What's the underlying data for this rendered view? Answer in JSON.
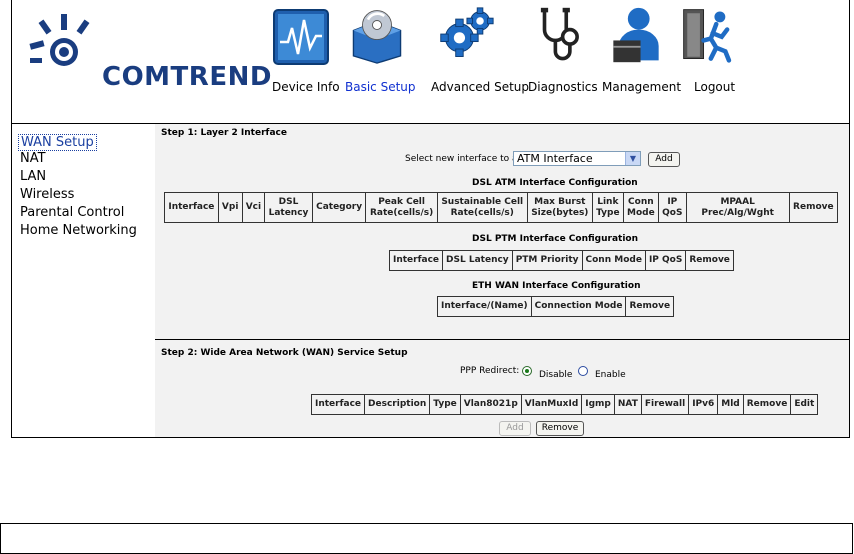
{
  "brand": {
    "logo_text": "COMTREND"
  },
  "nav": [
    {
      "label": "Device Info",
      "icon": "device-info-icon"
    },
    {
      "label": "Basic Setup",
      "icon": "basic-setup-icon",
      "active": true
    },
    {
      "label": "Advanced Setup",
      "icon": "advanced-setup-icon"
    },
    {
      "label": "Diagnostics",
      "icon": "diagnostics-icon"
    },
    {
      "label": "Management",
      "icon": "management-icon"
    },
    {
      "label": "Logout",
      "icon": "logout-icon"
    }
  ],
  "sidebar": [
    {
      "label": "WAN Setup",
      "active": true
    },
    {
      "label": "NAT"
    },
    {
      "label": "LAN"
    },
    {
      "label": "Wireless"
    },
    {
      "label": "Parental Control"
    },
    {
      "label": "Home Networking"
    }
  ],
  "step1": {
    "title": "Step 1: Layer 2 Interface",
    "select_label": "Select new interface to add:",
    "select_value": "ATM Interface",
    "add_button": "Add",
    "atm_caption": "DSL ATM Interface Configuration",
    "atm_headers": [
      [
        "Interface",
        ""
      ],
      [
        "Vpi",
        ""
      ],
      [
        "Vci",
        ""
      ],
      [
        "DSL",
        "Latency"
      ],
      [
        "Category",
        ""
      ],
      [
        "Peak Cell",
        "Rate(cells/s)"
      ],
      [
        "Sustainable Cell",
        "Rate(cells/s)"
      ],
      [
        "Max Burst",
        "Size(bytes)"
      ],
      [
        "Link",
        "Type"
      ],
      [
        "Conn",
        "Mode"
      ],
      [
        "IP",
        "QoS"
      ],
      [
        "MPAAL",
        "Prec/Alg/Wght"
      ],
      [
        "Remove",
        ""
      ]
    ],
    "ptm_caption": "DSL PTM Interface Configuration",
    "ptm_headers": [
      "Interface",
      "DSL Latency",
      "PTM Priority",
      "Conn Mode",
      "IP QoS",
      "Remove"
    ],
    "eth_caption": "ETH WAN Interface Configuration",
    "eth_headers": [
      "Interface/(Name)",
      "Connection Mode",
      "Remove"
    ]
  },
  "step2": {
    "title": "Step 2: Wide Area Network (WAN) Service Setup",
    "ppp_label": "PPP Redirect:",
    "ppp_options": [
      "Disable",
      "Enable"
    ],
    "ppp_selected": "Disable",
    "wan_headers": [
      "Interface",
      "Description",
      "Type",
      "Vlan8021p",
      "VlanMuxId",
      "Igmp",
      "NAT",
      "Firewall",
      "IPv6",
      "Mld",
      "Remove",
      "Edit"
    ],
    "add_button": "Add",
    "remove_button": "Remove"
  },
  "colors": {
    "active_nav": "#1030d0",
    "content_bg": "#f2f2f2",
    "brand": "#1a3d80"
  }
}
